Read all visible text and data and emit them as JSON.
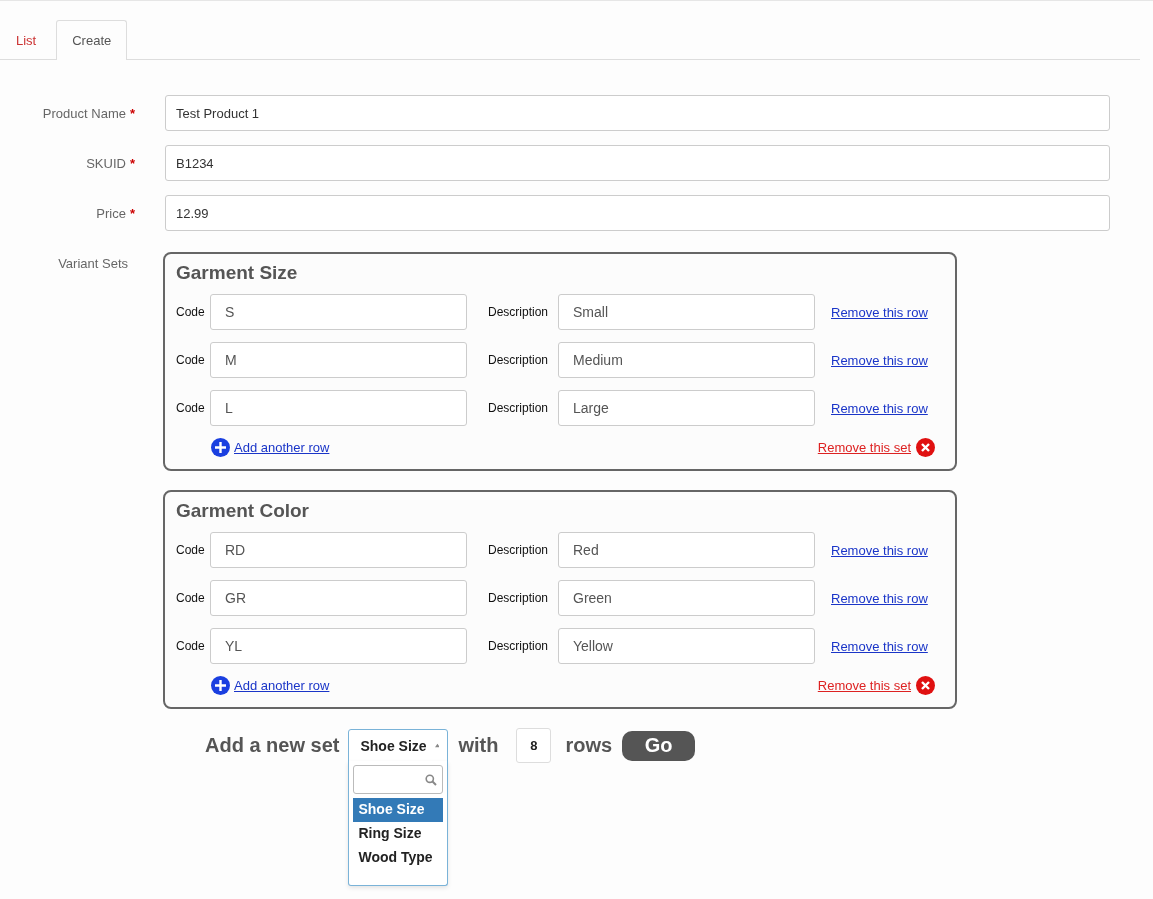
{
  "tabs": [
    {
      "label": "List",
      "selected": false
    },
    {
      "label": "Create",
      "selected": true
    }
  ],
  "fields": [
    {
      "label": "Product Name",
      "required_mark": "*",
      "value": "Test Product 1"
    },
    {
      "label": "SKUID",
      "required_mark": "*",
      "value": "B1234"
    },
    {
      "label": "Price",
      "required_mark": "*",
      "value": "12.99"
    }
  ],
  "variant_sets": {
    "label": "Variant Sets",
    "sets": [
      {
        "title": "Garment Size",
        "rows": [
          {
            "code_label": "Code",
            "code": "S",
            "description_label": "Description",
            "description": "Small",
            "remove_link": "Remove this row"
          },
          {
            "code_label": "Code",
            "code": "M",
            "description_label": "Description",
            "description": "Medium",
            "remove_link": "Remove this row"
          },
          {
            "code_label": "Code",
            "code": "L",
            "description_label": "Description",
            "description": "Large",
            "remove_link": "Remove this row"
          }
        ],
        "add_row_link": "Add another row",
        "remove_set_link": "Remove this set"
      },
      {
        "title": "Garment Color",
        "rows": [
          {
            "code_label": "Code",
            "code": "RD",
            "description_label": "Description",
            "description": "Red",
            "remove_link": "Remove this row"
          },
          {
            "code_label": "Code",
            "code": "GR",
            "description_label": "Description",
            "description": "Green",
            "remove_link": "Remove this row"
          },
          {
            "code_label": "Code",
            "code": "YL",
            "description_label": "Description",
            "description": "Yellow",
            "remove_link": "Remove this row"
          }
        ],
        "add_row_link": "Add another row",
        "remove_set_link": "Remove this set"
      }
    ]
  },
  "add_set": {
    "prefix": "Add a new set",
    "select": {
      "value": "Shoe Size",
      "expanded": true,
      "options": [
        {
          "label": "Shoe Size",
          "selected": true
        },
        {
          "label": "Ring Size",
          "selected": false
        },
        {
          "label": "Wood Type",
          "selected": false
        }
      ]
    },
    "with_label": "with",
    "rows_count": "8",
    "rows_label": "rows",
    "button": "Go"
  }
}
